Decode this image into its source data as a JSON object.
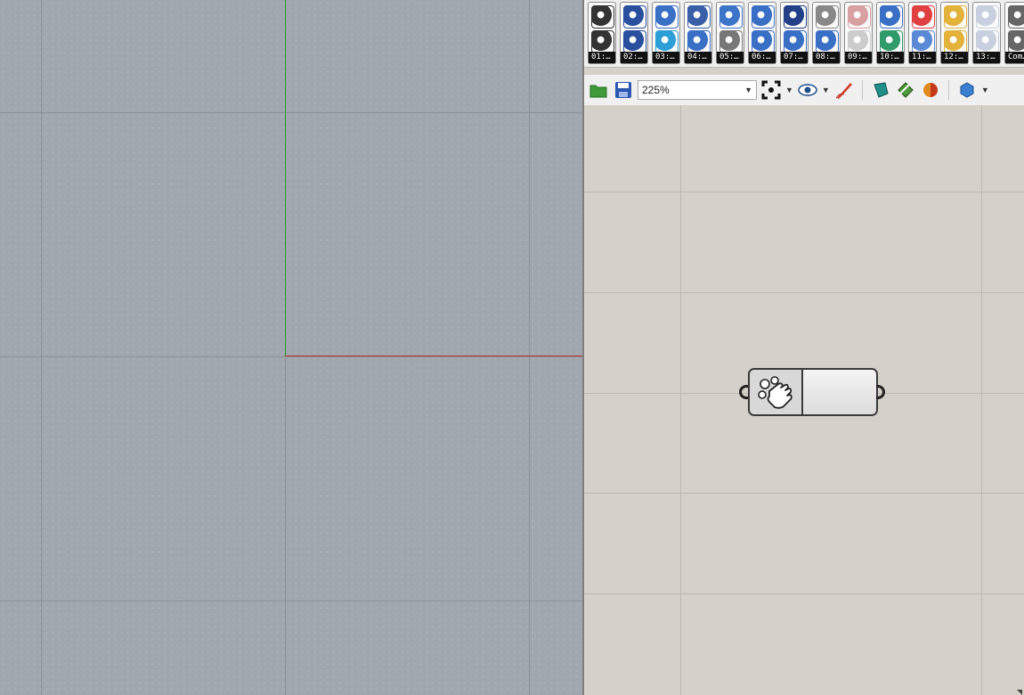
{
  "viewport": {
    "grid": "on",
    "axes": {
      "x_axis_color": "#c0302a",
      "y_axis_color": "#2f9a2f"
    }
  },
  "grasshopper": {
    "tabs": [
      {
        "label": "01:…",
        "icons": [
          "curve-icon",
          "circle-icon"
        ],
        "colors": [
          "#333333",
          "#333333"
        ]
      },
      {
        "label": "02:…",
        "icons": [
          "points-icon",
          "points-icon"
        ],
        "colors": [
          "#2a4f9e",
          "#2a4f9e"
        ]
      },
      {
        "label": "03:…",
        "icons": [
          "surface-re-icon",
          "surface-sq-icon"
        ],
        "colors": [
          "#3a6fc6",
          "#2e9fd6"
        ]
      },
      {
        "label": "04:…",
        "icons": [
          "mesh-icon",
          "mesh-box-icon"
        ],
        "colors": [
          "#3a5fa8",
          "#3a6fc6"
        ]
      },
      {
        "label": "05:…",
        "icons": [
          "sphere-icon",
          "boolean-icon"
        ],
        "colors": [
          "#3c74c8",
          "#777777"
        ]
      },
      {
        "label": "06:…",
        "icons": [
          "transform-icon",
          "transform-icon"
        ],
        "colors": [
          "#3a6fc6",
          "#3a6fc6"
        ]
      },
      {
        "label": "07:…",
        "icons": [
          "text-icon",
          "globe-icon"
        ],
        "colors": [
          "#233f88",
          "#3a6fc6"
        ]
      },
      {
        "label": "08:…",
        "icons": [
          "hand-icon",
          "gears-icon"
        ],
        "colors": [
          "#888888",
          "#3a6fc6"
        ]
      },
      {
        "label": "09:…",
        "icons": [
          "render-icon",
          "render-icon"
        ],
        "colors": [
          "#d8a0a0",
          "#cccccc"
        ]
      },
      {
        "label": "10:…",
        "icons": [
          "bent-plane-icon",
          "bent-plane-icon"
        ],
        "colors": [
          "#3a6fc6",
          "#2f9a6a"
        ]
      },
      {
        "label": "11:…",
        "icons": [
          "color-grid-icon",
          "panel-icon"
        ],
        "colors": [
          "#e04040",
          "#5a8ad6"
        ]
      },
      {
        "label": "12:…",
        "icons": [
          "toolbox-icon",
          "stack-icon"
        ],
        "colors": [
          "#e2b23a",
          "#e2b23a"
        ]
      },
      {
        "label": "13:…",
        "icons": [
          "box-icon",
          "shape-icon"
        ],
        "colors": [
          "#c8d0e0",
          "#c8d0e0"
        ]
      },
      {
        "label": "Com…",
        "icons": [
          "figure-icon",
          "figure-icon"
        ],
        "colors": [
          "#666666",
          "#666666"
        ]
      }
    ],
    "toolbar": {
      "zoom_value": "225%"
    },
    "component": {
      "type": "button",
      "icon": "hand-click-icon"
    }
  }
}
